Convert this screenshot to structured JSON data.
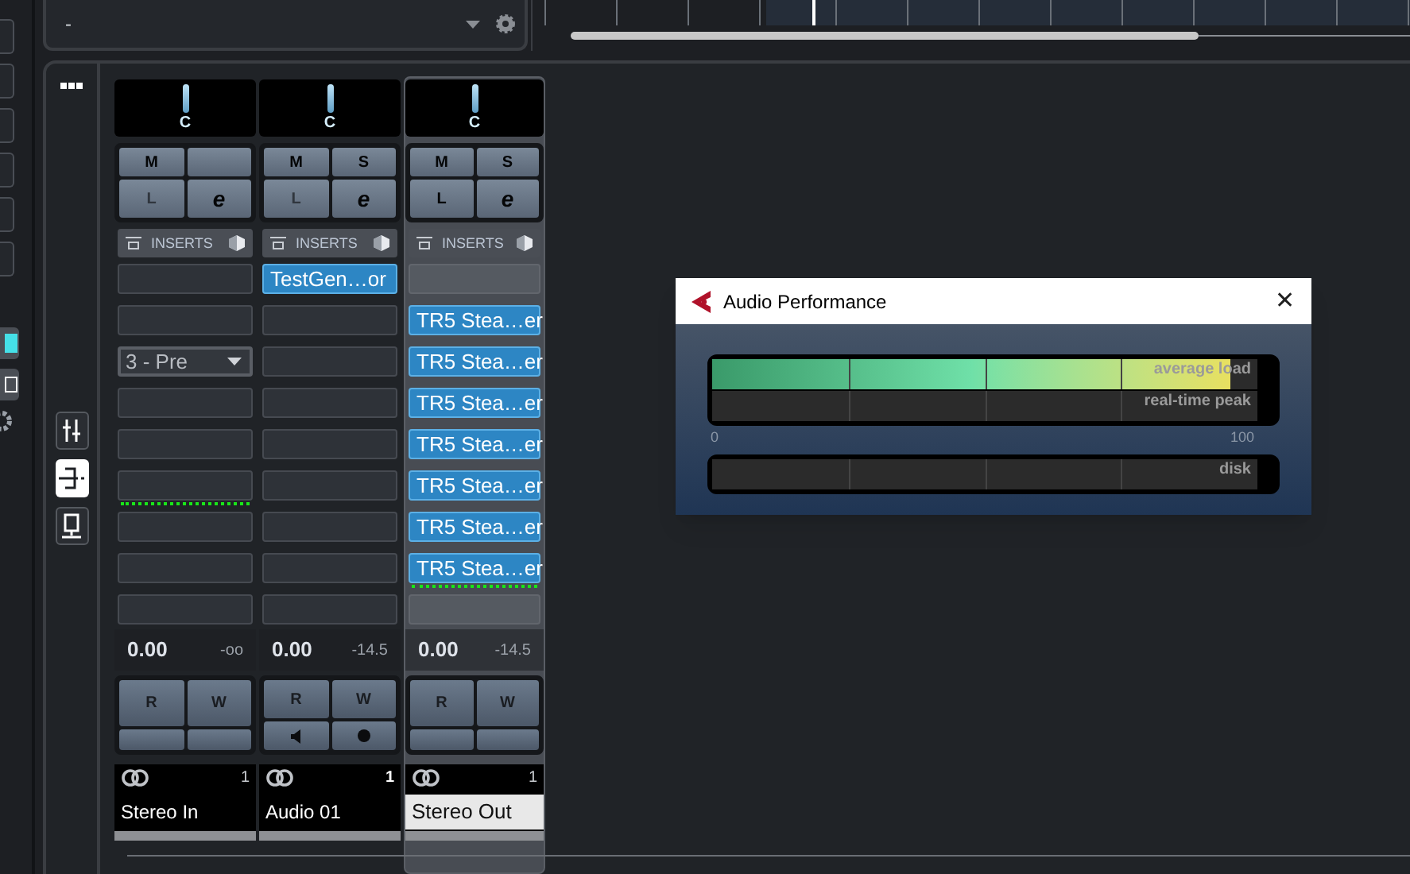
{
  "top_panel": {
    "value": "-"
  },
  "side_tools": [
    {
      "kind": "faders",
      "selected": false
    },
    {
      "kind": "inserts",
      "selected": true
    },
    {
      "kind": "monitor",
      "selected": false
    }
  ],
  "channels": [
    {
      "selected": false,
      "pan": "C",
      "buttons": [
        {
          "kind": "text",
          "label": "M",
          "dim": false
        },
        {
          "kind": "blank"
        },
        {
          "kind": "text",
          "label": "L",
          "dim": true
        },
        {
          "kind": "text",
          "label": "e",
          "dim": false
        }
      ],
      "inserts_label": "INSERTS",
      "slots": [
        {
          "kind": "empty",
          "signal": false
        },
        {
          "kind": "empty",
          "signal": false
        },
        {
          "kind": "dropdown",
          "label": "3 - Pre",
          "signal": false
        },
        {
          "kind": "empty",
          "signal": false
        },
        {
          "kind": "empty",
          "signal": false
        },
        {
          "kind": "empty",
          "signal": true
        },
        {
          "kind": "empty",
          "signal": false
        },
        {
          "kind": "empty",
          "signal": false
        },
        {
          "kind": "empty",
          "signal": false
        }
      ],
      "volume": "0.00",
      "peak": "-oo",
      "automation": [
        {
          "kind": "text",
          "label": "R"
        },
        {
          "kind": "text",
          "label": "W"
        },
        {
          "kind": "blank"
        },
        {
          "kind": "blank"
        }
      ],
      "number": "1",
      "name": "Stereo In"
    },
    {
      "selected": false,
      "pan": "C",
      "buttons": [
        {
          "kind": "text",
          "label": "M",
          "dim": false
        },
        {
          "kind": "text",
          "label": "S",
          "dim": false
        },
        {
          "kind": "text",
          "label": "L",
          "dim": true
        },
        {
          "kind": "text",
          "label": "e",
          "dim": false
        }
      ],
      "inserts_label": "INSERTS",
      "slots": [
        {
          "kind": "plugin",
          "label": "TestGen…or",
          "signal": false
        },
        {
          "kind": "empty",
          "signal": false
        },
        {
          "kind": "empty",
          "signal": false
        },
        {
          "kind": "empty",
          "signal": false
        },
        {
          "kind": "empty",
          "signal": false
        },
        {
          "kind": "empty",
          "signal": false
        },
        {
          "kind": "empty",
          "signal": false
        },
        {
          "kind": "empty",
          "signal": false
        },
        {
          "kind": "empty",
          "signal": false
        }
      ],
      "volume": "0.00",
      "peak": "-14.5",
      "automation": [
        {
          "kind": "text",
          "label": "R"
        },
        {
          "kind": "text",
          "label": "W"
        },
        {
          "kind": "speaker"
        },
        {
          "kind": "record"
        }
      ],
      "number": "1",
      "name": "Audio 01"
    },
    {
      "selected": true,
      "pan": "C",
      "buttons": [
        {
          "kind": "text",
          "label": "M",
          "dim": false
        },
        {
          "kind": "text",
          "label": "S",
          "dim": false
        },
        {
          "kind": "text",
          "label": "L",
          "dim": false
        },
        {
          "kind": "text",
          "label": "e",
          "dim": false
        }
      ],
      "inserts_label": "INSERTS",
      "slots": [
        {
          "kind": "empty",
          "signal": false
        },
        {
          "kind": "plugin",
          "label": "TR5 Stea…er",
          "signal": false
        },
        {
          "kind": "plugin",
          "label": "TR5 Stea…er",
          "signal": false
        },
        {
          "kind": "plugin",
          "label": "TR5 Stea…er",
          "signal": false
        },
        {
          "kind": "plugin",
          "label": "TR5 Stea…er",
          "signal": false
        },
        {
          "kind": "plugin",
          "label": "TR5 Stea…er",
          "signal": false
        },
        {
          "kind": "plugin",
          "label": "TR5 Stea…er",
          "signal": false
        },
        {
          "kind": "plugin",
          "label": "TR5 Stea…er",
          "signal": true
        },
        {
          "kind": "empty",
          "signal": false
        }
      ],
      "volume": "0.00",
      "peak": "-14.5",
      "automation": [
        {
          "kind": "text",
          "label": "R"
        },
        {
          "kind": "text",
          "label": "W"
        },
        {
          "kind": "blank"
        },
        {
          "kind": "blank"
        }
      ],
      "number": "1",
      "name": "Stereo Out"
    }
  ],
  "dialog": {
    "title": "Audio Performance",
    "close": "✕",
    "meters": [
      {
        "label": "average load",
        "level": 0.95
      },
      {
        "label": "real-time peak",
        "level": 0
      }
    ],
    "scale_min": "0",
    "scale_max": "100",
    "disk": {
      "label": "disk",
      "level": 0
    }
  }
}
